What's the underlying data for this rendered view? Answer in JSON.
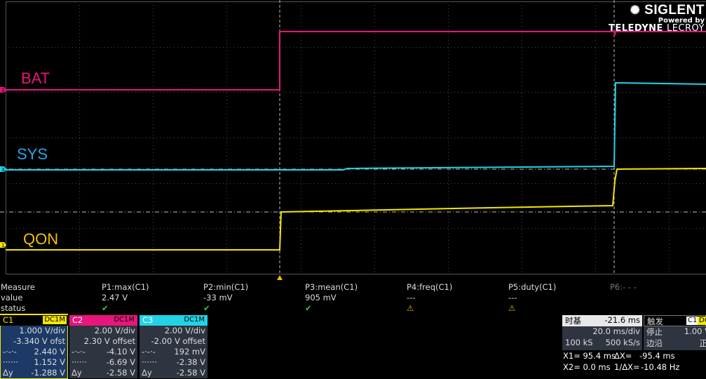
{
  "brand": {
    "name": "SIGLENT",
    "powered": "Powered by",
    "partner_a": "TELEDYNE",
    "partner_b": "LECROY"
  },
  "trace_labels": {
    "bat": "BAT",
    "sys": "SYS",
    "qon": "QON"
  },
  "channel_markers": {
    "c1": "1",
    "c2": "2",
    "c3": "3"
  },
  "colors": {
    "c1": "#f2e600",
    "c2": "#e8157a",
    "c3": "#22d3e6"
  },
  "measure": {
    "headers": [
      "Measure",
      "P1:max(C1)",
      "P2:min(C1)",
      "P3:mean(C1)",
      "P4:freq(C1)",
      "P5:duty(C1)",
      "P6:- - -"
    ],
    "value_label": "value",
    "values": [
      "2.47 V",
      "-33 mV",
      "905 mV",
      "---",
      "---"
    ],
    "status_label": "status",
    "status": [
      "ok",
      "ok",
      "ok",
      "warn",
      "warn"
    ]
  },
  "channels": [
    {
      "name": "C1",
      "coupling": "DC1M",
      "scale": "1.000 V/div",
      "offset": "-3.340 V ofst",
      "ya_val": "2.440 V",
      "yb_val": "1.152 V",
      "dy_label": "Δy",
      "dy_val": "-1.288 V"
    },
    {
      "name": "C2",
      "coupling": "DC1M",
      "scale": "2.00 V/div",
      "offset": "2.30 V offset",
      "ya_val": "-4.10 V",
      "yb_val": "-6.69 V",
      "dy_label": "Δy",
      "dy_val": "-2.58 V"
    },
    {
      "name": "C3",
      "coupling": "DC1M",
      "scale": "2.00 V/div",
      "offset": "-2.00 V offset",
      "ya_val": "192 mV",
      "yb_val": "-2.38 V",
      "dy_label": "Δy",
      "dy_val": "-2.58 V"
    }
  ],
  "timebase": {
    "label": "时基",
    "delay": "-21.6 ms",
    "scale": "20.0 ms/div",
    "points": "100 kS",
    "rate": "500 kS/s"
  },
  "trigger": {
    "label": "触发",
    "source": "C1",
    "coupling": "DC",
    "mode": "停止",
    "level": "1.00 V",
    "slope_label": "边沿",
    "slope": "正"
  },
  "cursors": {
    "x1": "X1= 95.4 ms",
    "dx": "ΔX=",
    "dx_val": "-95.4 ms",
    "x2": "X2= 0.0 ms",
    "inv_dx": "1/ΔX=",
    "inv_dx_val": "-10.48 Hz"
  }
}
